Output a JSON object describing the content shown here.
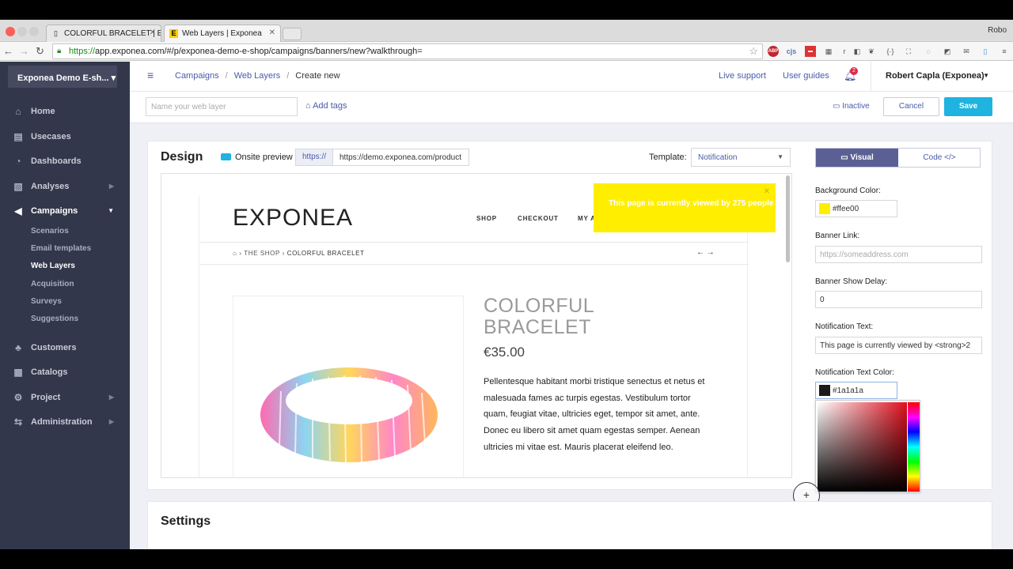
{
  "browser": {
    "tabs": [
      {
        "title": "COLORFUL BRACELET | Ex"
      },
      {
        "title": "Web Layers | Exponea"
      }
    ],
    "profile_name": "Robo",
    "url_scheme": "https://",
    "url_rest": "app.exponea.com/#/p/exponea-demo-e-shop/campaigns/banners/new?walkthrough=",
    "extensions": [
      "ABP",
      "cjs",
      "r",
      "{·}"
    ]
  },
  "sidebar": {
    "project": "Exponea Demo E-sh... ▾",
    "items": [
      {
        "label": "Home",
        "icon": "⌂"
      },
      {
        "label": "Usecases",
        "icon": "▤"
      },
      {
        "label": "Dashboards",
        "icon": "◔"
      },
      {
        "label": "Analyses",
        "icon": "▧"
      },
      {
        "label": "Campaigns",
        "icon": "◀"
      },
      {
        "label": "Customers",
        "icon": "♣"
      },
      {
        "label": "Catalogs",
        "icon": "▦"
      },
      {
        "label": "Project",
        "icon": "⚙"
      },
      {
        "label": "Administration",
        "icon": "⇆"
      }
    ],
    "subitems": [
      "Scenarios",
      "Email templates",
      "Web Layers",
      "Acquisition",
      "Surveys",
      "Suggestions"
    ]
  },
  "topbar": {
    "crumb1": "Campaigns",
    "crumb2": "Web Layers",
    "crumb3": "Create new",
    "live_support": "Live support",
    "user_guides": "User guides",
    "notif_count": "2",
    "user": "Robert Capla (Exponea)"
  },
  "secbar": {
    "name_placeholder": "Name your web layer",
    "add_tags": "Add tags",
    "status": "Inactive",
    "cancel": "Cancel",
    "save": "Save"
  },
  "design": {
    "title": "Design",
    "onsite_preview": "Onsite preview",
    "url_prefix": "https://",
    "url_value": "https://demo.exponea.com/product",
    "template_label": "Template:",
    "template_value": "Notification"
  },
  "shop": {
    "logo": "EXPONEA",
    "nav": [
      "SHOP",
      "CHECKOUT",
      "MY A"
    ],
    "breadcrumb_home": "⌂",
    "breadcrumb_shop": "THE SHOP",
    "breadcrumb_product": "COLORFUL BRACELET",
    "title_line1": "COLORFUL",
    "title_line2": "BRACELET",
    "price": "€35.00",
    "description": "Pellentesque habitant morbi tristique senectus et netus et malesuada fames ac turpis egestas. Vestibulum tortor quam, feugiat vitae, ultricies eget, tempor sit amet, ante. Donec eu libero sit amet quam egestas semper. Aenean ultricies mi vitae est. Mauris placerat eleifend leo."
  },
  "notification": {
    "text": "This page is currently viewed by 275 people",
    "color": "#ffee00"
  },
  "panel": {
    "tab_visual": "Visual",
    "tab_code": "Code </>",
    "bg_color_label": "Background Color:",
    "bg_color_value": "#ffee00",
    "banner_link_label": "Banner Link:",
    "banner_link_placeholder": "https://someaddress.com",
    "delay_label": "Banner Show Delay:",
    "delay_value": "0",
    "notif_text_label": "Notification Text:",
    "notif_text_value": "This page is currently viewed by <strong>2",
    "notif_color_label": "Notification Text Color:",
    "notif_color_value": "#1a1a1a"
  },
  "settings": {
    "title": "Settings"
  }
}
